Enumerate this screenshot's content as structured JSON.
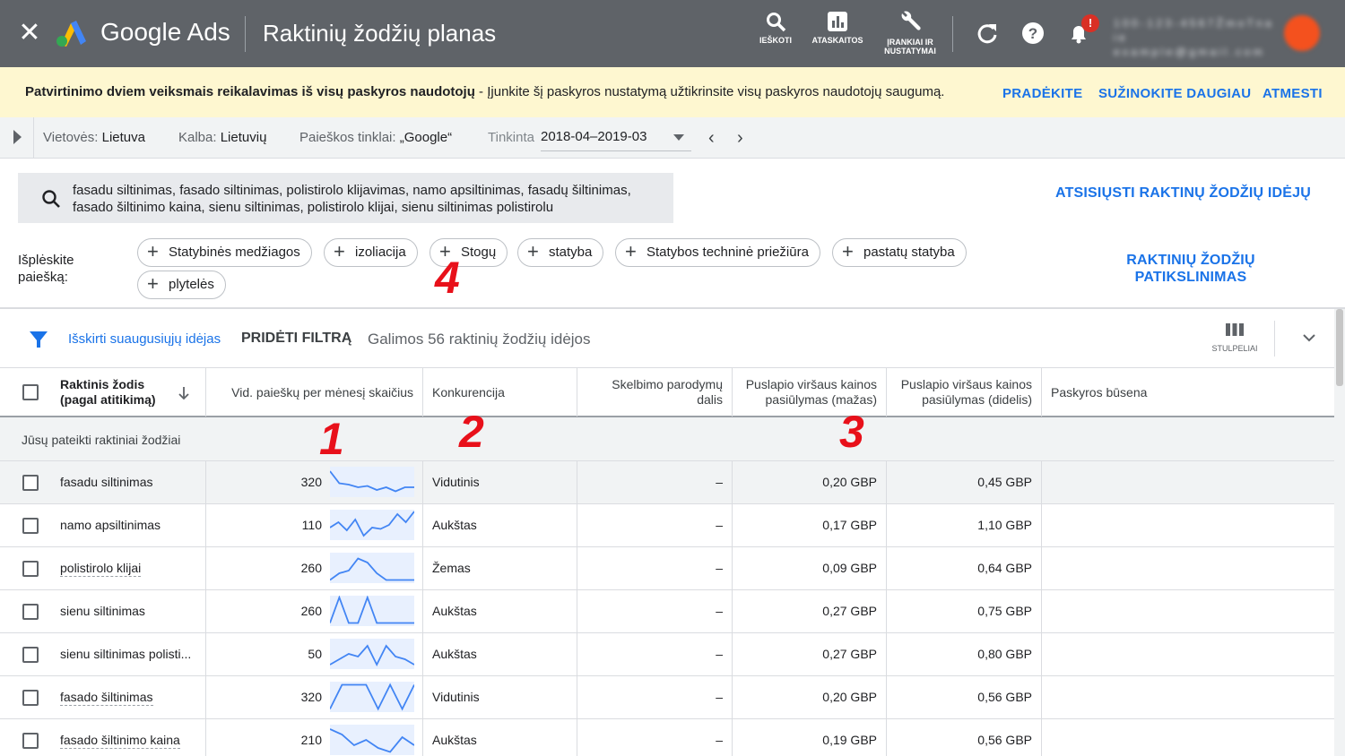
{
  "topbar": {
    "brand": "Google Ads",
    "page_title": "Raktinių žodžių planas",
    "tools": [
      {
        "label": "IEŠKOTI",
        "icon": "search-icon"
      },
      {
        "label": "ATASKAITOS",
        "icon": "reports-icon"
      },
      {
        "label_line1": "ĮRANKIAI IR",
        "label_line2": "NUSTATYMAI",
        "icon": "wrench-icon"
      }
    ],
    "notification_badge": "!",
    "account_line1": "1 0 0 - 1 2 3 - 4 5 6 7   Ž m o   T n a i e",
    "account_line2": "e x a m p l e @ g m a i l . c o m",
    "accent": "#1a73e8"
  },
  "banner": {
    "bold_text": "Patvirtinimo dviem veiksmais reikalavimas iš visų paskyros naudotojų",
    "text": " - Įjunkite šį paskyros nustatymą užtikrinsite visų paskyros naudotojų saugumą.",
    "actions": [
      "PRADĖKITE",
      "SUŽINOKITE DAUGIAU",
      "ATMESTI"
    ]
  },
  "filters": {
    "location_label": "Vietovės:",
    "location_value": "Lietuva",
    "language_label": "Kalba:",
    "language_value": "Lietuvių",
    "network_label": "Paieškos tinklai:",
    "network_value": "„Google“",
    "date_label": "Tinkinta",
    "date_value": "2018-04–2019-03"
  },
  "search": {
    "query_line1": "fasadu siltinimas, fasado siltinimas, polistirolo klijavimas, namo apsiltinimas, fasadų šiltinimas,",
    "query_line2": "fasado šiltinimo kaina, sienu siltinimas, polistirolo klijai, sienu siltinimas polistirolu",
    "download_link": "ATSISIŲSTI RAKTINŲ ŽODŽIŲ IDĖJŲ"
  },
  "expand": {
    "label_line1": "Išplėskite",
    "label_line2": "paiešką:",
    "chips": [
      "Statybinės medžiagos",
      "izoliacija",
      "Stogų",
      "statyba",
      "Statybos techninė priežiūra",
      "pastatų statyba",
      "plytelės"
    ],
    "refine_line1": "RAKTINIŲ ŽODŽIŲ",
    "refine_line2": "PATIKSLINIMAS"
  },
  "annotations": [
    "1",
    "2",
    "3",
    "4"
  ],
  "toolbar": {
    "adult_filter": "Išskirti suaugusiųjų idėjas",
    "add_filter": "PRIDĖTI FILTRĄ",
    "count_text": "Galimos 56 raktinių žodžių idėjos",
    "columns_label": "STULPELIAI"
  },
  "table": {
    "headers": {
      "keyword_line1": "Raktinis žodis",
      "keyword_line2": "(pagal atitikimą)",
      "searches": "Vid. paieškų per mėnesį skaičius",
      "competition": "Konkurencija",
      "impr_share_line1": "Skelbimo parodymų",
      "impr_share_line2": "dalis",
      "bid_low_line1": "Puslapio viršaus kainos",
      "bid_low_line2": "pasiūlymas (mažas)",
      "bid_high_line1": "Puslapio viršaus kainos",
      "bid_high_line2": "pasiūlymas (didelis)",
      "status": "Paskyros būsena"
    },
    "group_label": "Jūsų pateikti raktiniai žodžiai",
    "rows": [
      {
        "keyword": "fasadu siltinimas",
        "searches": "320",
        "competition": "Vidutinis",
        "share": "–",
        "low": "0,20 GBP",
        "high": "0,45 GBP",
        "trend": [
          0.9,
          0.45,
          0.4,
          0.3,
          0.35,
          0.2,
          0.3,
          0.15,
          0.3,
          0.3
        ]
      },
      {
        "keyword": "namo apsiltinimas",
        "searches": "110",
        "competition": "Aukštas",
        "share": "–",
        "low": "0,17 GBP",
        "high": "1,10 GBP",
        "trend": [
          0.4,
          0.6,
          0.3,
          0.7,
          0.1,
          0.4,
          0.35,
          0.5,
          0.9,
          0.6,
          1.0
        ]
      },
      {
        "keyword": "polistirolo klijai",
        "searches": "260",
        "competition": "Žemas",
        "share": "–",
        "low": "0,09 GBP",
        "high": "0,64 GBP",
        "trend": [
          0.05,
          0.3,
          0.4,
          0.85,
          0.7,
          0.3,
          0.05,
          0.05,
          0.05,
          0.05
        ]
      },
      {
        "keyword": "sienu siltinimas",
        "searches": "260",
        "competition": "Aukštas",
        "share": "–",
        "low": "0,27 GBP",
        "high": "0,75 GBP",
        "trend": [
          0.05,
          1.0,
          0.05,
          0.05,
          1.0,
          0.05,
          0.05,
          0.05,
          0.05,
          0.05
        ]
      },
      {
        "keyword": "sienu siltinimas polisti...",
        "searches": "50",
        "competition": "Aukštas",
        "share": "–",
        "low": "0,27 GBP",
        "high": "0,80 GBP",
        "trend": [
          0.1,
          0.3,
          0.5,
          0.4,
          0.8,
          0.1,
          0.8,
          0.4,
          0.3,
          0.1
        ]
      },
      {
        "keyword": "fasado šiltinimas",
        "searches": "320",
        "competition": "Vidutinis",
        "share": "–",
        "low": "0,20 GBP",
        "high": "0,56 GBP",
        "trend": [
          0.05,
          0.95,
          0.95,
          0.95,
          0.05,
          0.95,
          0.05,
          0.95
        ]
      },
      {
        "keyword": "fasado šiltinimo kaina",
        "searches": "210",
        "competition": "Aukštas",
        "share": "–",
        "low": "0,19 GBP",
        "high": "0,56 GBP",
        "trend": [
          0.9,
          0.7,
          0.3,
          0.5,
          0.2,
          0.05,
          0.6,
          0.3
        ]
      }
    ]
  }
}
